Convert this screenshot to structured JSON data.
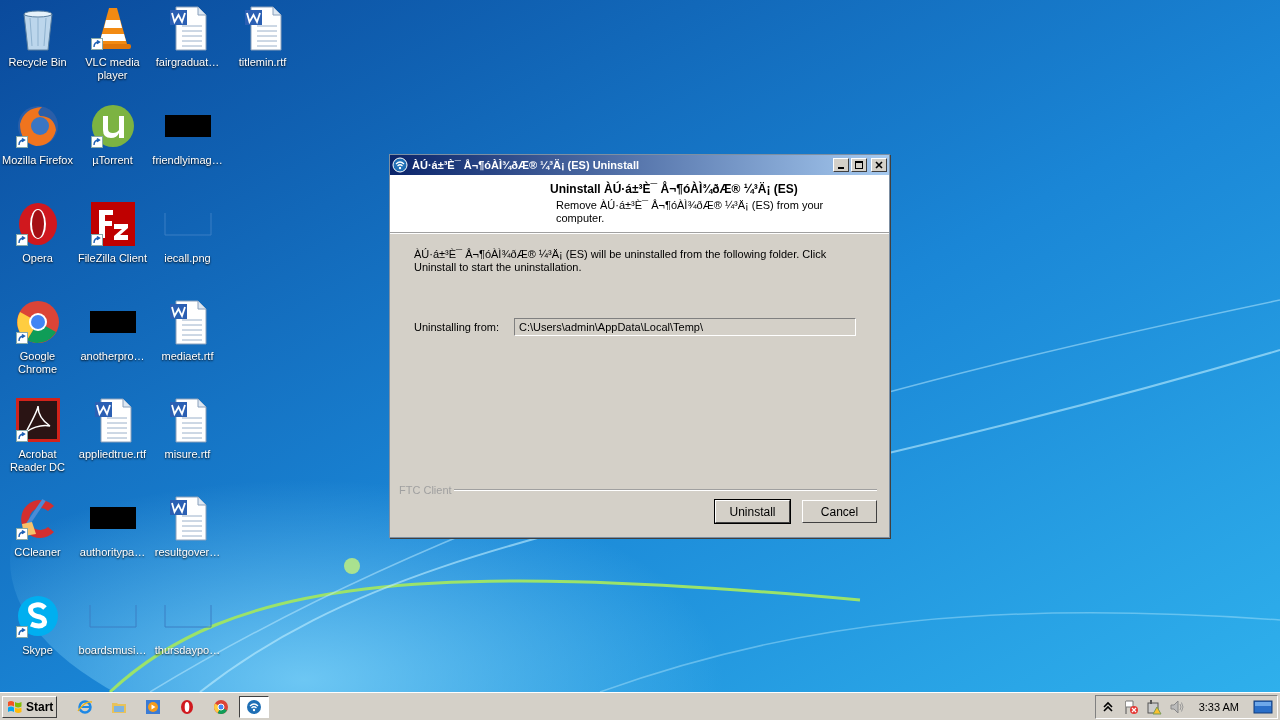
{
  "desktop": {
    "columns": [
      [
        {
          "label": "Recycle Bin",
          "kind": "recycle",
          "shortcut": false
        },
        {
          "label": "Mozilla Firefox",
          "kind": "firefox",
          "shortcut": true
        },
        {
          "label": "Opera",
          "kind": "opera",
          "shortcut": true
        },
        {
          "label": "Google Chrome",
          "kind": "chrome",
          "shortcut": true
        },
        {
          "label": "Acrobat Reader DC",
          "kind": "acrobat",
          "shortcut": true
        },
        {
          "label": "CCleaner",
          "kind": "ccleaner",
          "shortcut": true
        },
        {
          "label": "Skype",
          "kind": "skype",
          "shortcut": true
        }
      ],
      [
        {
          "label": "VLC media player",
          "kind": "vlc",
          "shortcut": true
        },
        {
          "label": "µTorrent",
          "kind": "utorrent",
          "shortcut": true
        },
        {
          "label": "FileZilla Client",
          "kind": "filezilla",
          "shortcut": true
        },
        {
          "label": "anotherpro…",
          "kind": "dark",
          "shortcut": false
        },
        {
          "label": "appliedtrue.rtf",
          "kind": "word",
          "shortcut": false
        },
        {
          "label": "authoritypa…",
          "kind": "dark",
          "shortcut": false
        },
        {
          "label": "boardsmusi…",
          "kind": "blank",
          "shortcut": false
        }
      ],
      [
        {
          "label": "fairgraduat…",
          "kind": "word",
          "shortcut": false
        },
        {
          "label": "friendlyimag…",
          "kind": "dark",
          "shortcut": false
        },
        {
          "label": "iecall.png",
          "kind": "blank",
          "shortcut": false
        },
        {
          "label": "mediaet.rtf",
          "kind": "word",
          "shortcut": false
        },
        {
          "label": "misure.rtf",
          "kind": "word",
          "shortcut": false
        },
        {
          "label": "resultgover…",
          "kind": "word",
          "shortcut": false
        },
        {
          "label": "thursdaypo…",
          "kind": "blank",
          "shortcut": false
        }
      ],
      [
        {
          "label": "titlemin.rtf",
          "kind": "word",
          "shortcut": false
        }
      ]
    ]
  },
  "dialog": {
    "title": "ÀÚ·á±³È¯ Å¬¶óÀÌ¾ðÆ® ¼³Ä¡ (ES) Uninstall",
    "heading": "Uninstall ÀÚ·á±³È¯ Å¬¶óÀÌ¾ðÆ® ¼³Ä¡ (ES)",
    "subheading": "Remove ÀÚ·á±³È¯ Å¬¶óÀÌ¾ðÆ® ¼³Ä¡ (ES) from your computer.",
    "description": "ÀÚ·á±³È¯ Å¬¶óÀÌ¾ðÆ® ¼³Ä¡ (ES) will be uninstalled from the following folder. Click Uninstall to start the uninstallation.",
    "field_label": "Uninstalling from:",
    "field_value": "C:\\Users\\admin\\AppData\\Local\\Temp\\",
    "brand": "FTC Client",
    "buttons": [
      {
        "label": "Uninstall",
        "default": true
      },
      {
        "label": "Cancel",
        "default": false
      }
    ]
  },
  "taskbar": {
    "start": "Start",
    "quick_launch": [
      {
        "kind": "ie"
      },
      {
        "kind": "folder"
      },
      {
        "kind": "media"
      },
      {
        "kind": "opera"
      },
      {
        "kind": "chrome"
      }
    ],
    "tasks": [
      {
        "kind": "installer",
        "selected": true
      }
    ],
    "tray": [
      {
        "kind": "chevron"
      },
      {
        "kind": "flag"
      },
      {
        "kind": "network"
      },
      {
        "kind": "speaker"
      }
    ],
    "clock": "3:33 AM"
  }
}
